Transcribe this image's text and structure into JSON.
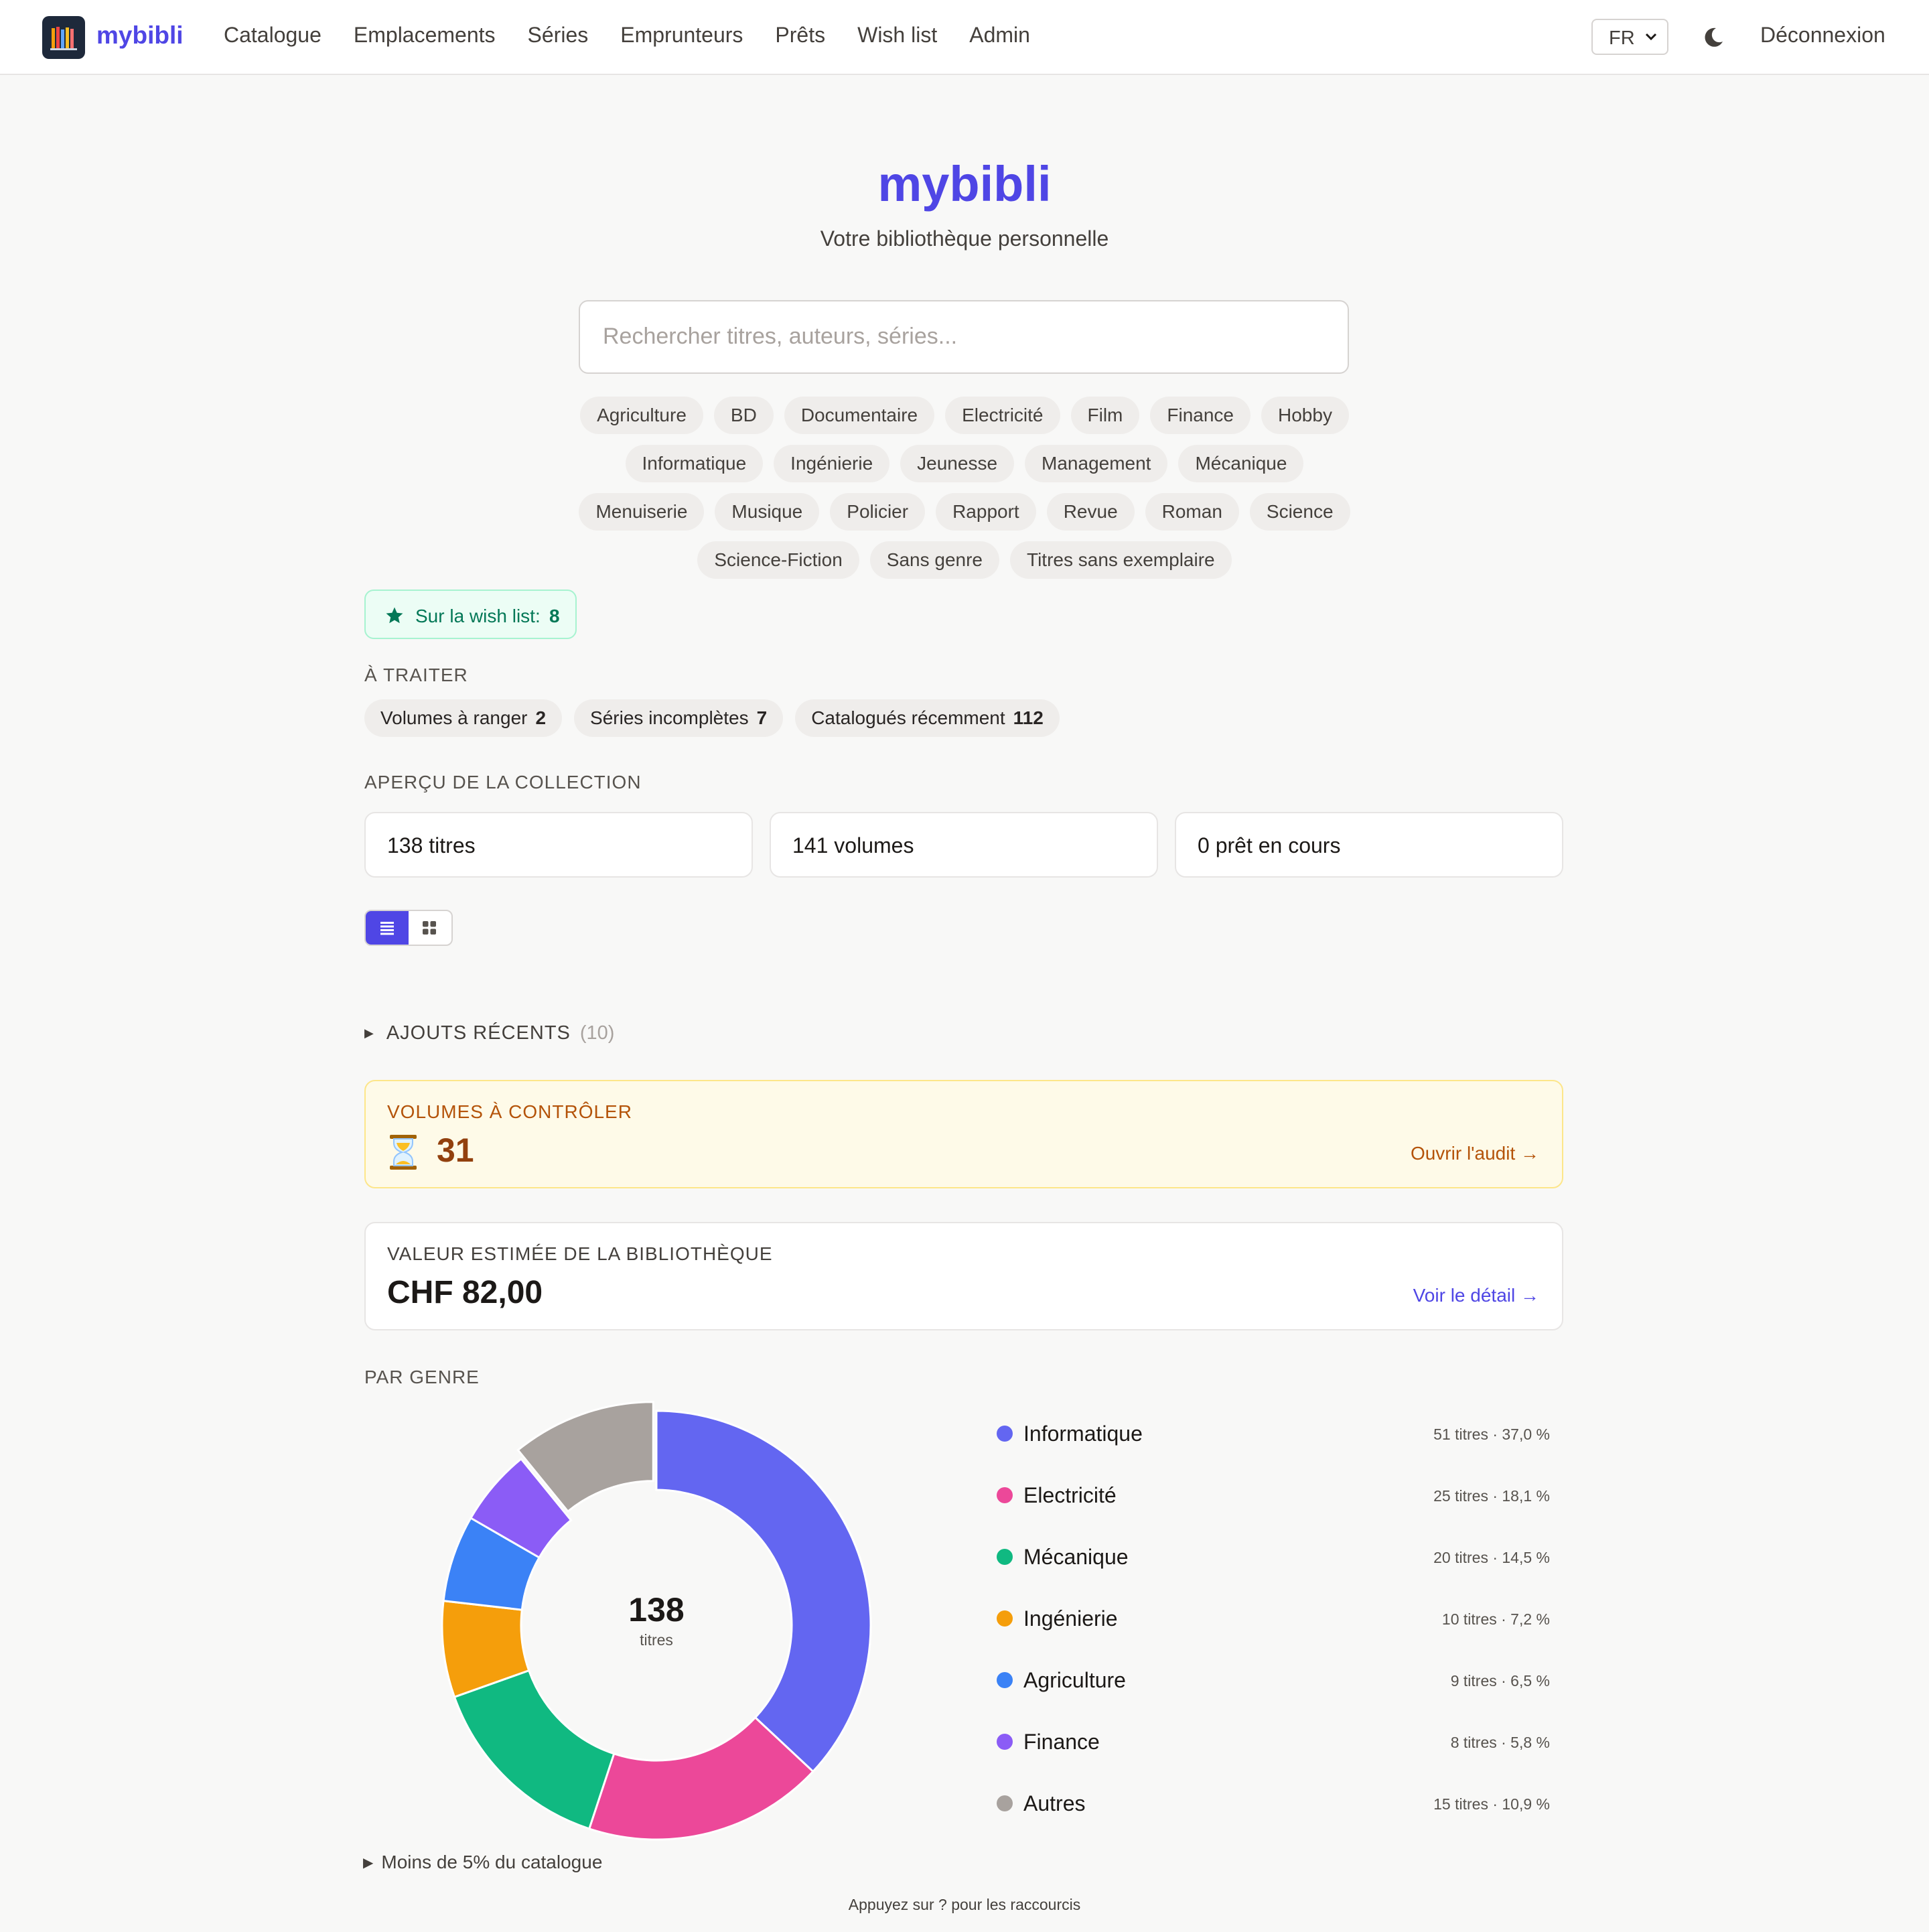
{
  "header": {
    "brand": "mybibli",
    "nav": [
      "Catalogue",
      "Emplacements",
      "Séries",
      "Emprunteurs",
      "Prêts",
      "Wish list",
      "Admin"
    ],
    "language": "FR",
    "logout_label": "Déconnexion",
    "icons": {
      "logo": "bookshelf-logo-icon",
      "theme": "moon-icon",
      "lang": "chevron-down-icon"
    }
  },
  "hero": {
    "title": "mybibli",
    "subtitle": "Votre bibliothèque personnelle",
    "search_placeholder": "Rechercher titres, auteurs, séries..."
  },
  "genre_chips": [
    [
      "Agriculture",
      "BD",
      "Documentaire",
      "Electricité",
      "Film",
      "Finance",
      "Hobby"
    ],
    [
      "Informatique",
      "Ingénierie",
      "Jeunesse",
      "Management",
      "Mécanique"
    ],
    [
      "Menuiserie",
      "Musique",
      "Policier",
      "Rapport",
      "Revue",
      "Roman",
      "Science"
    ],
    [
      "Science-Fiction",
      "Sans genre",
      "Titres sans exemplaire"
    ]
  ],
  "wishlist": {
    "label": "Sur la wish list:",
    "count": "8",
    "icon": "star-icon"
  },
  "todo": {
    "title": "À TRAITER",
    "items": [
      {
        "label": "Volumes à ranger",
        "count": "2"
      },
      {
        "label": "Séries incomplètes",
        "count": "7"
      },
      {
        "label": "Catalogués récemment",
        "count": "112"
      }
    ]
  },
  "overview": {
    "title": "APERÇU DE LA COLLECTION",
    "stats": [
      "138 titres",
      "141 volumes",
      "0 prêt en cours"
    ],
    "view_toggle": {
      "active": "list",
      "icons": [
        "list-view-icon",
        "grid-view-icon"
      ]
    }
  },
  "recent": {
    "label": "AJOUTS RÉCENTS",
    "count": "(10)"
  },
  "audit": {
    "label": "VOLUMES À CONTRÔLER",
    "icon": "hourglass-icon",
    "value": "31",
    "link": "Ouvrir l'audit →"
  },
  "valuation": {
    "label": "VALEUR ESTIMÉE DE LA BIBLIOTHÈQUE",
    "value": "CHF 82,00",
    "link": "Voir le détail →"
  },
  "by_genre": {
    "title": "PAR GENRE",
    "center_value": "138",
    "center_label": "titres",
    "legend": [
      {
        "name": "Informatique",
        "meta": "51 titres · 37,0 %",
        "color": "#6366f1"
      },
      {
        "name": "Electricité",
        "meta": "25 titres · 18,1 %",
        "color": "#ec4899"
      },
      {
        "name": "Mécanique",
        "meta": "20 titres · 14,5 %",
        "color": "#10b981"
      },
      {
        "name": "Ingénierie",
        "meta": "10 titres · 7,2 %",
        "color": "#f59e0b"
      },
      {
        "name": "Agriculture",
        "meta": "9 titres · 6,5 %",
        "color": "#3b82f6"
      },
      {
        "name": "Finance",
        "meta": "8 titres · 5,8 %",
        "color": "#8b5cf6"
      },
      {
        "name": "Autres",
        "meta": "15 titres · 10,9 %",
        "color": "#a8a29e"
      }
    ],
    "less_than": "Moins de 5% du catalogue"
  },
  "chart_data": {
    "type": "pie",
    "categories": [
      "Informatique",
      "Electricité",
      "Mécanique",
      "Ingénierie",
      "Agriculture",
      "Finance",
      "Autres"
    ],
    "values": [
      51,
      25,
      20,
      10,
      9,
      8,
      15
    ],
    "colors": [
      "#6366f1",
      "#ec4899",
      "#10b981",
      "#f59e0b",
      "#3b82f6",
      "#8b5cf6",
      "#a8a29e"
    ],
    "total": 138
  },
  "footer": {
    "hint": "Appuyez sur ? pour les raccourcis"
  }
}
